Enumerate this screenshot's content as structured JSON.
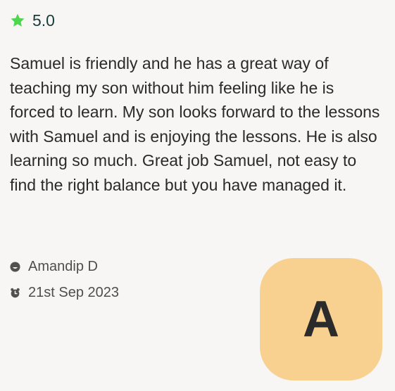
{
  "rating": {
    "icon": "star-icon",
    "icon_color": "#4fd64f",
    "value": "5.0"
  },
  "review": {
    "text": "Samuel is friendly and he has a great way of teaching my son without him feeling like he is forced to learn. My son looks forward to the lessons with Samuel and is enjoying the lessons. He is also learning so much. Great job Samuel, not easy to find the right balance but you have managed it."
  },
  "reviewer": {
    "icon": "smiley-icon",
    "name": "Amandip D"
  },
  "date": {
    "icon": "alarm-clock-icon",
    "value": "21st Sep 2023"
  },
  "avatar": {
    "initial": "A",
    "background": "#f8d08f"
  }
}
